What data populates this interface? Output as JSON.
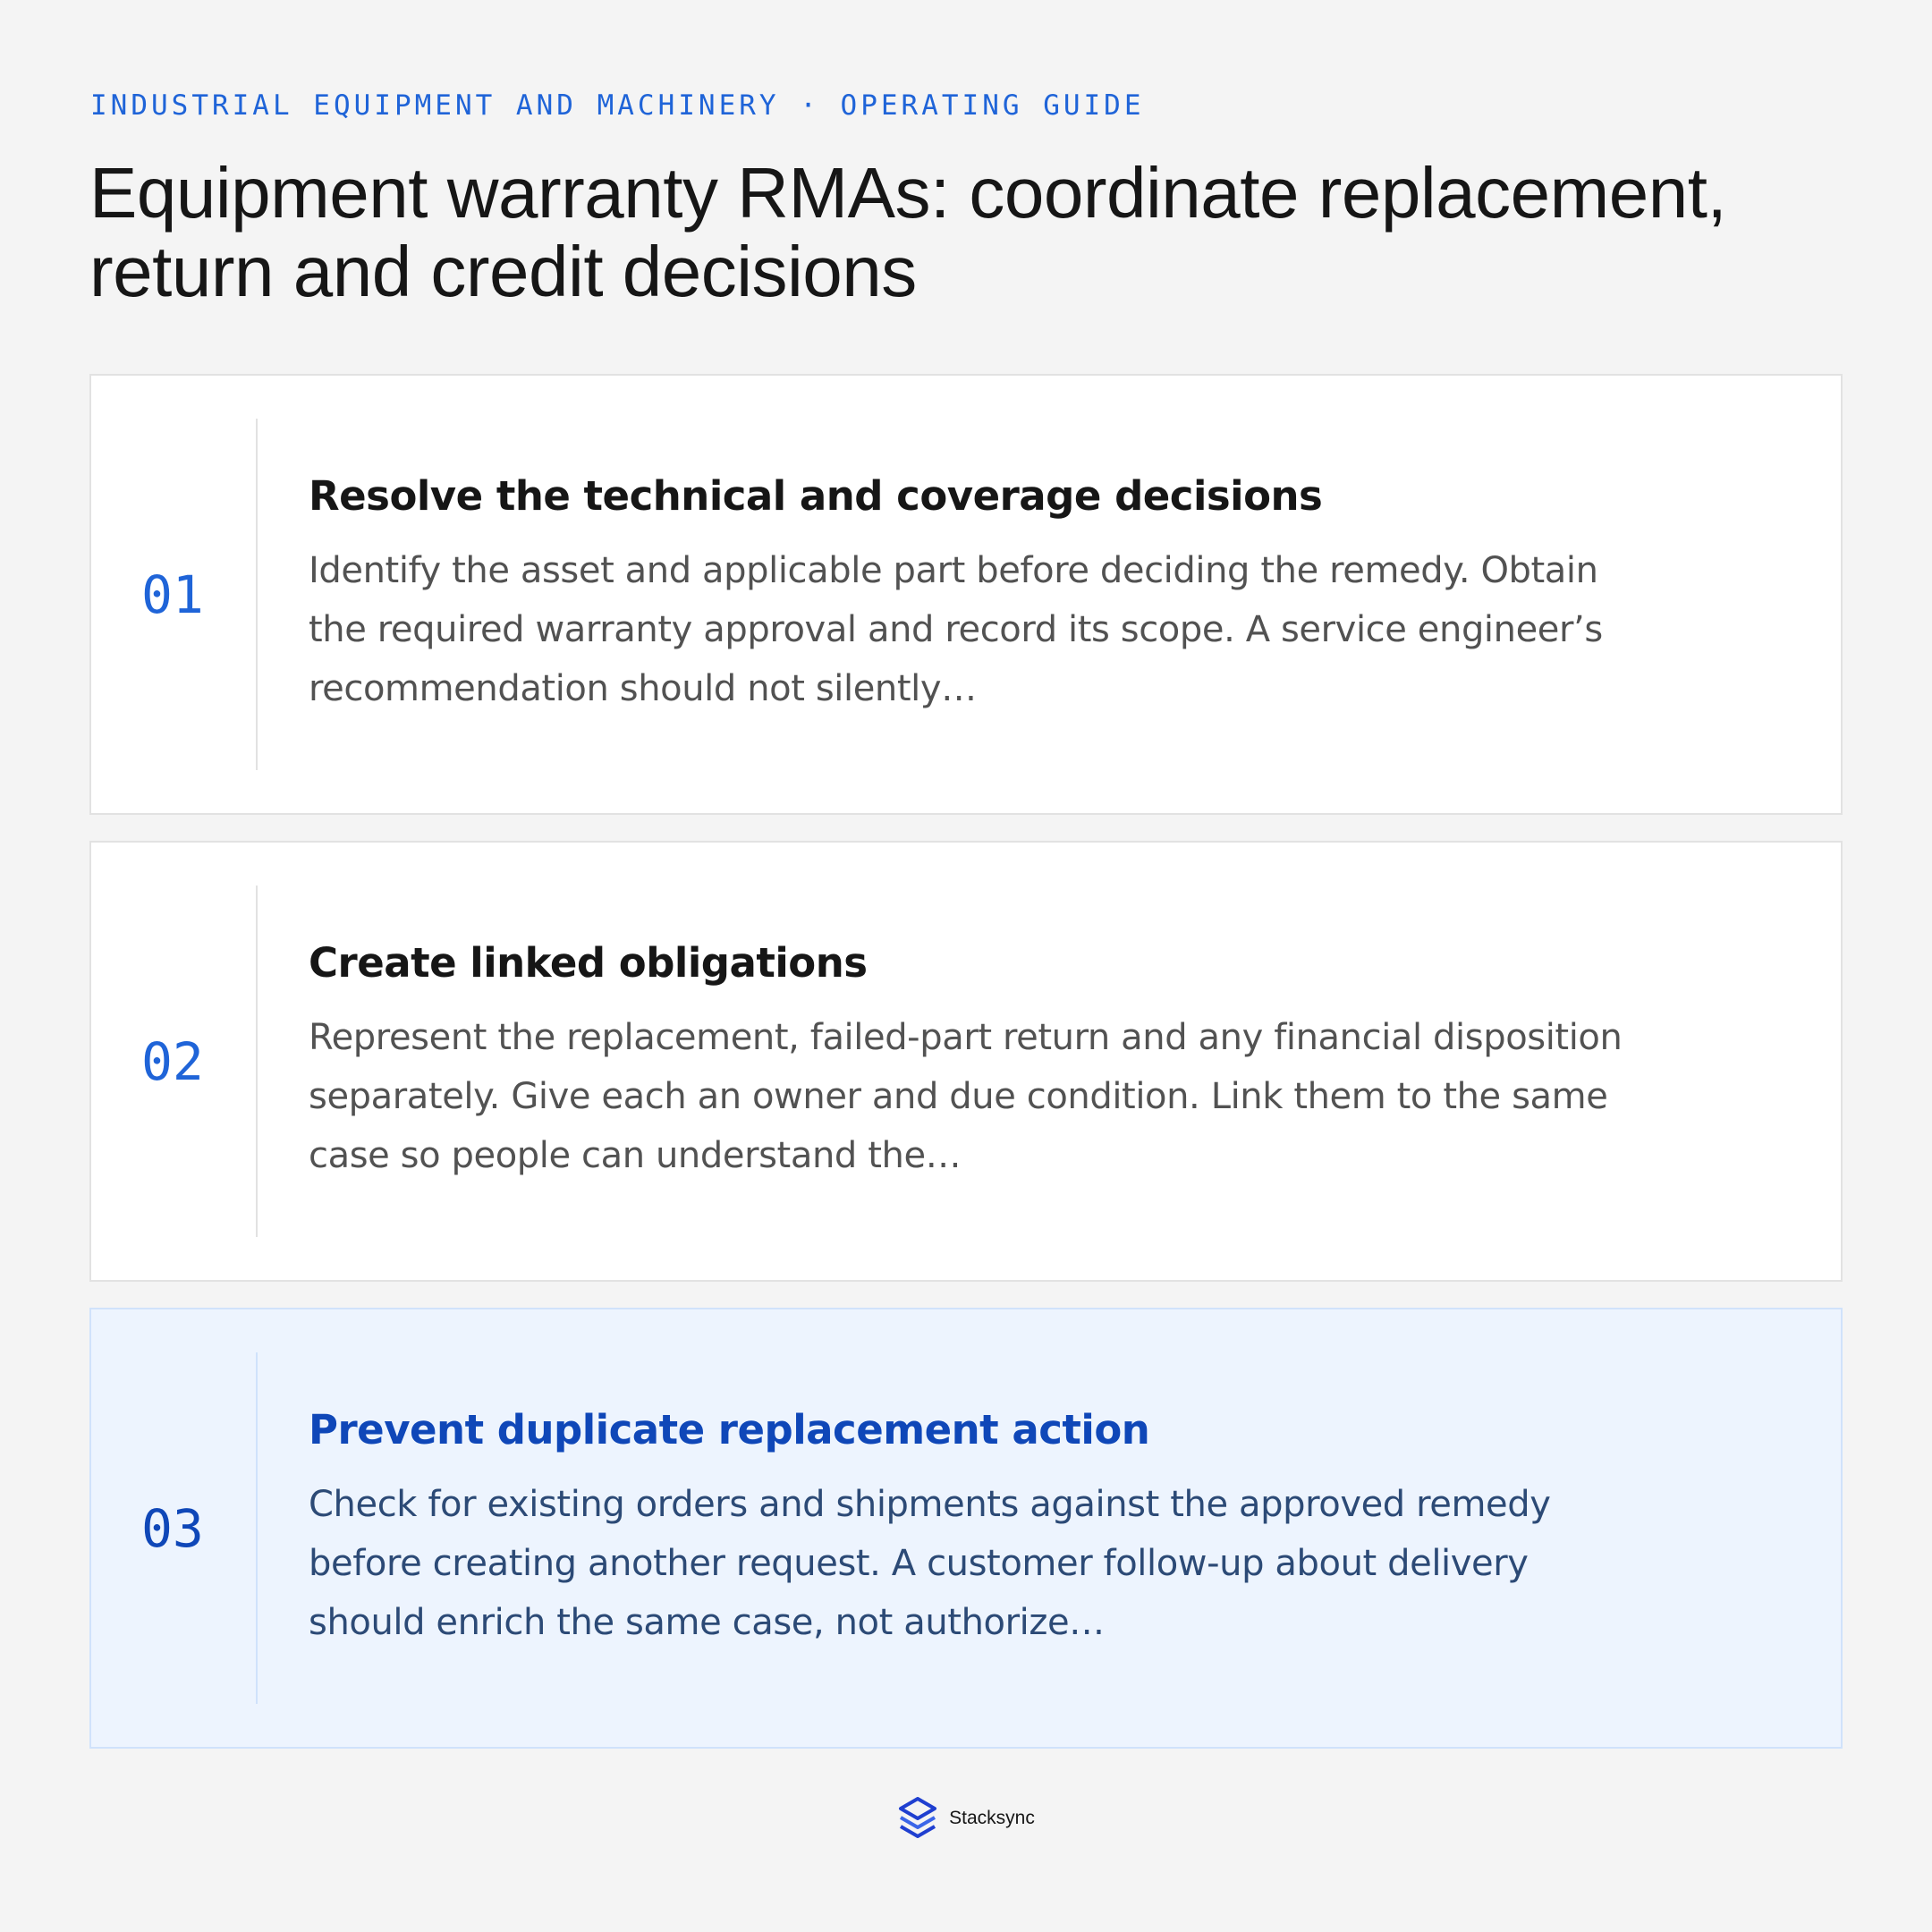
{
  "header": {
    "eyebrow": "INDUSTRIAL EQUIPMENT AND MACHINERY · OPERATING GUIDE",
    "title": "Equipment warranty RMAs: coordinate replacement, return and credit decisions"
  },
  "steps": [
    {
      "number": "01",
      "title": "Resolve the technical and coverage decisions",
      "text": "Identify the asset and applicable part before deciding the remedy. Obtain the required warranty approval and record its scope. A service engineer’s recommendation should not silently…",
      "highlighted": false
    },
    {
      "number": "02",
      "title": "Create linked obligations",
      "text": "Represent the replacement, failed-part return and any financial disposition separately. Give each an owner and due condition. Link them to the same case so people can understand the…",
      "highlighted": false
    },
    {
      "number": "03",
      "title": "Prevent duplicate replacement action",
      "text": "Check for existing orders and shipments against the approved remedy before creating another request. A customer follow-up about delivery should enrich the same case, not authorize…",
      "highlighted": true
    }
  ],
  "footer": {
    "brand": "Stacksync",
    "logo_icon": "stacked-layers-icon"
  },
  "colors": {
    "accent": "#1f64d8",
    "accent_dark": "#0f47b8",
    "highlight_bg": "#edf4fe",
    "background": "#f4f4f4"
  }
}
